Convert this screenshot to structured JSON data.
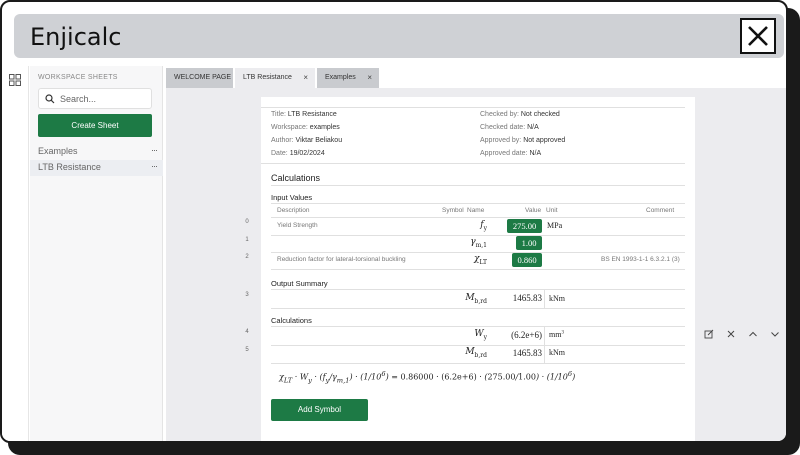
{
  "app": {
    "title": "Enjicalc"
  },
  "sidebar": {
    "heading": "WORKSPACE SHEETS",
    "search_placeholder": "Search...",
    "create_label": "Create Sheet",
    "items": [
      {
        "label": "Examples",
        "menu": "···"
      },
      {
        "label": "LTB Resistance",
        "menu": "···"
      }
    ]
  },
  "tabs": [
    {
      "label": "WELCOME PAGE"
    },
    {
      "label": "LTB Resistance",
      "close": "×"
    },
    {
      "label": "Examples",
      "close": "×"
    }
  ],
  "sheet": {
    "meta": {
      "title_label": "Title:",
      "title_value": "LTB Resistance",
      "workspace_label": "Workspace:",
      "workspace_value": "examples",
      "author_label": "Author:",
      "author_value": "Viktar Beliakou",
      "date_label": "Date:",
      "date_value": "19/02/2024",
      "checked_by_label": "Checked by:",
      "checked_by_value": "Not checked",
      "checked_date_label": "Checked date:",
      "checked_date_value": "N/A",
      "approved_by_label": "Approved by:",
      "approved_by_value": "Not approved",
      "approved_date_label": "Approved date:",
      "approved_date_value": "N/A"
    },
    "section_title": "Calculations",
    "input_title": "Input Values",
    "columns": {
      "description": "Description",
      "symbol": "Symbol",
      "name": "Name",
      "value": "Value",
      "unit": "Unit",
      "comment": "Comment"
    },
    "inputs": [
      {
        "num": "0",
        "description": "Yield Strength",
        "sym": "f",
        "sub": "y",
        "value": "275.00",
        "unit": "MPa",
        "comment": ""
      },
      {
        "num": "1",
        "description": "",
        "sym": "γ",
        "sub": "m,1",
        "value": "1.00",
        "unit": "",
        "comment": ""
      },
      {
        "num": "2",
        "description": "Reduction factor for lateral-torsional buckling",
        "sym": "χ",
        "sub": "LT",
        "value": "0.860",
        "unit": "",
        "comment": "BS EN 1993-1-1 6.3.2.1 (3)"
      }
    ],
    "output_title": "Output Summary",
    "outputs": [
      {
        "num": "3",
        "sym": "M",
        "sub": "b,rd",
        "value": "1465.83",
        "unit": "kNm"
      }
    ],
    "calc_title": "Calculations",
    "calcs": [
      {
        "num": "4",
        "sym": "W",
        "sub": "y",
        "value": "(6.2e+6)",
        "unit": "mm",
        "unit_sup": "3"
      },
      {
        "num": "5",
        "sym": "M",
        "sub": "b,rd",
        "value": "1465.83",
        "unit": "kNm",
        "unit_sup": ""
      }
    ],
    "formula": {
      "chi": "χ",
      "chi_sub": "LT",
      "w": "W",
      "w_sub": "y",
      "fy": "f",
      "fy_sub": "y",
      "gamma": "γ",
      "gamma_sub": "m,1",
      "one": "1",
      "ten": "10",
      "ten_sup": "6",
      "result": "= 0.86000 · (6.2e+6) ·",
      "num_val": "275.00",
      "den_val": "1.00"
    },
    "add_symbol_label": "Add Symbol"
  }
}
